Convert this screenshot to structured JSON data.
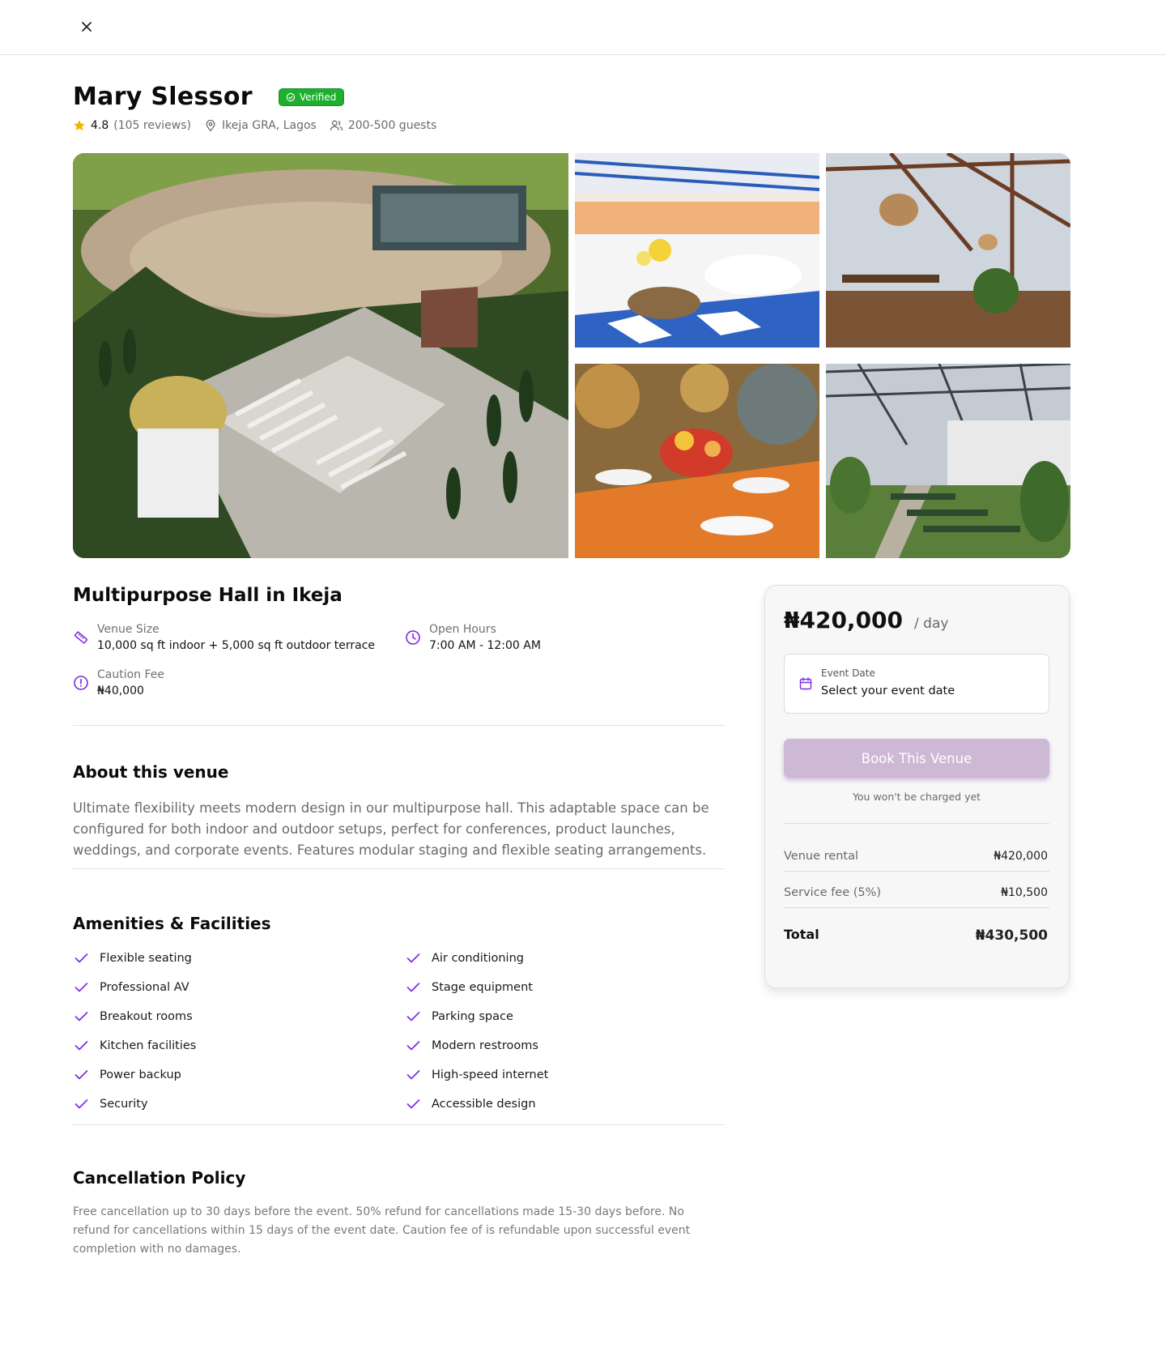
{
  "venue": {
    "name": "Mary Slessor",
    "verified_label": "Verified",
    "rating": "4.8",
    "reviews": "(105 reviews)",
    "location": "Ikeja GRA, Lagos",
    "capacity": "200-500 guests"
  },
  "listing": {
    "title": "Multipurpose Hall in Ikeja",
    "specs": {
      "size_label": "Venue Size",
      "size_value": "10,000 sq ft indoor + 5,000 sq ft outdoor terrace",
      "hours_label": "Open Hours",
      "hours_value": "7:00 AM - 12:00 AM",
      "caution_label": "Caution Fee",
      "caution_value": "₦40,000"
    }
  },
  "about": {
    "heading": "About this venue",
    "text": "Ultimate flexibility meets modern design in our multipurpose hall. This adaptable space can be configured for both indoor and outdoor setups, perfect for conferences, product launches, weddings, and corporate events. Features modular staging and flexible seating arrangements."
  },
  "amenities": {
    "heading": "Amenities & Facilities",
    "left": [
      "Flexible seating",
      "Professional AV",
      "Breakout rooms",
      "Kitchen facilities",
      "Power backup",
      "Security"
    ],
    "right": [
      "Air conditioning",
      "Stage equipment",
      "Parking space",
      "Modern restrooms",
      "High-speed internet",
      "Accessible design"
    ]
  },
  "cancellation": {
    "heading": "Cancellation Policy",
    "text": "Free cancellation up to 30 days before the event. 50% refund for cancellations made 15-30 days before. No refund for cancellations within 15 days of the event date. Caution fee of is refundable upon successful event completion with no damages."
  },
  "booking": {
    "price": "₦420,000",
    "per": "/ day",
    "date_label": "Event Date",
    "date_placeholder": "Select your event date",
    "button": "Book This Venue",
    "note": "You won't be charged yet",
    "rental_label": "Venue rental",
    "rental_value": "₦420,000",
    "fee_label": "Service fee (5%)",
    "fee_value": "₦10,500",
    "total_label": "Total",
    "total_value": "₦430,500"
  },
  "colors": {
    "accent": "#7c2ae8",
    "verified": "#1fae2e",
    "star": "#f5b301",
    "button": "#cdb8d6"
  },
  "icons": [
    "close-icon",
    "check-circle-icon",
    "star-icon",
    "map-pin-icon",
    "users-icon",
    "ruler-icon",
    "clock-icon",
    "alert-circle-icon",
    "check-icon",
    "calendar-icon"
  ]
}
